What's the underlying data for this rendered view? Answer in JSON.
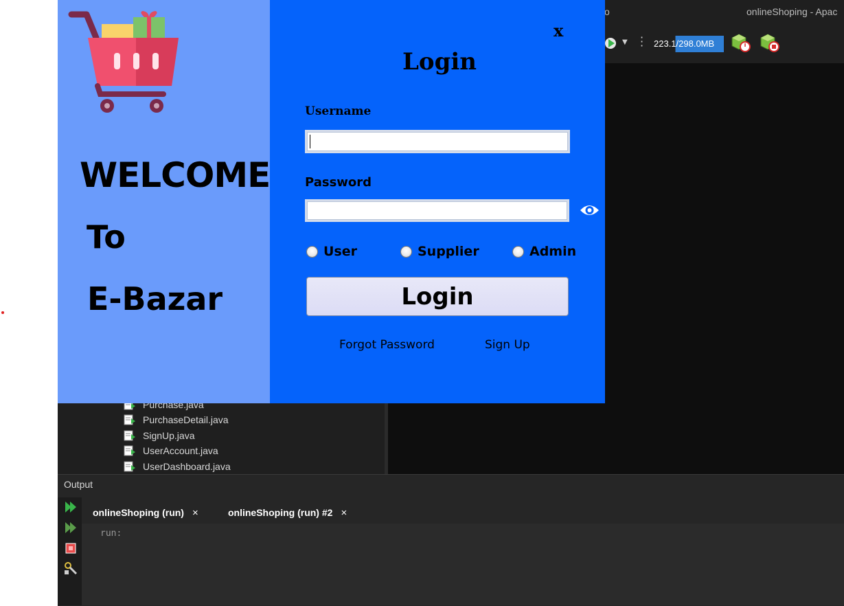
{
  "ide": {
    "window_title": "onlineShoping - Apac",
    "title_fragment": "o",
    "memory": "223.1/298.0MB",
    "project_files": [
      "Purchase.java",
      "PurchaseDetail.java",
      "SignUp.java",
      "UserAccount.java",
      "UserDashboard.java"
    ],
    "output": {
      "label": "Output",
      "tabs": [
        {
          "label": "onlineShoping (run)",
          "close": "×"
        },
        {
          "label": "onlineShoping (run) #2",
          "close": "×"
        }
      ],
      "console_text": "run:"
    }
  },
  "welcome_panel": {
    "line1": "WELCOME",
    "line2": "To",
    "line3": "E-Bazar",
    "icon": "shopping-cart-icon"
  },
  "login_form": {
    "close": "x",
    "title": "Login",
    "username_label": "Username",
    "username_value": "",
    "password_label": "Password",
    "password_value": "",
    "show_password_icon": "eye-icon",
    "roles": [
      "User",
      "Supplier",
      "Admin"
    ],
    "submit_label": "Login",
    "forgot_password": "Forgot Password",
    "sign_up": "Sign Up"
  },
  "colors": {
    "left_panel": "#6a9bfb",
    "right_panel": "#0563fb",
    "button": "#dcdcf5",
    "ide_dark": "#1f1f1f"
  }
}
